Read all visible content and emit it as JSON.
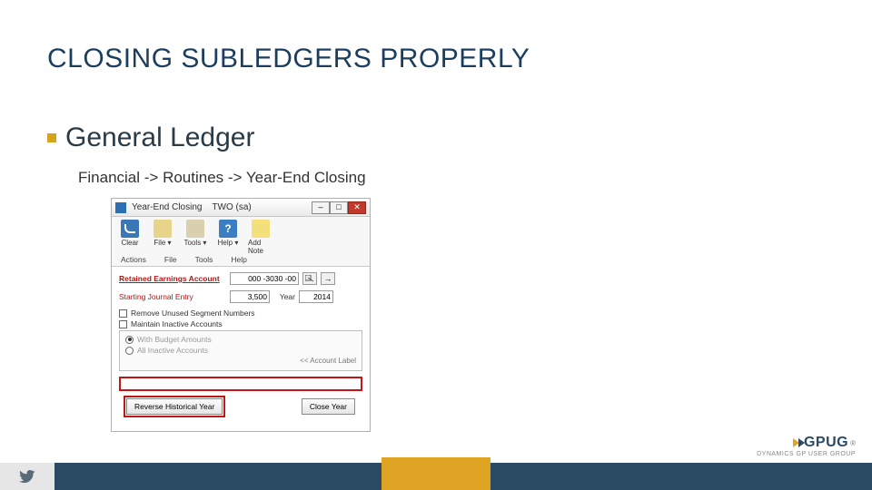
{
  "title": "CLOSING SUBLEDGERS PROPERLY",
  "bullet": "General Ledger",
  "breadcrumb": "Financial -> Routines -> Year-End Closing",
  "dialog": {
    "title": "Year-End Closing",
    "context": "TWO (sa)",
    "ribbon": [
      "Clear",
      "File ▾",
      "Tools ▾",
      "Help ▾",
      "Add Note"
    ],
    "tabs": [
      "Actions",
      "File",
      "Tools",
      "Help"
    ],
    "fields": {
      "retained_label": "Retained Earnings Account",
      "retained_value": "000 -3030 -00",
      "journal_label": "Starting Journal Entry",
      "journal_value": "3,500",
      "year_label": "Year",
      "year_value": "2014"
    },
    "checks": [
      "Remove Unused Segment Numbers",
      "Maintain Inactive Accounts"
    ],
    "radios": [
      "With Budget Amounts",
      "All Inactive Accounts"
    ],
    "acct_label": "<< Account Label",
    "buttons": {
      "reverse": "Reverse Historical Year",
      "close_year": "Close Year"
    }
  },
  "footer": {
    "logo": "GPUG",
    "logo_sub": "DYNAMICS GP USER GROUP"
  }
}
